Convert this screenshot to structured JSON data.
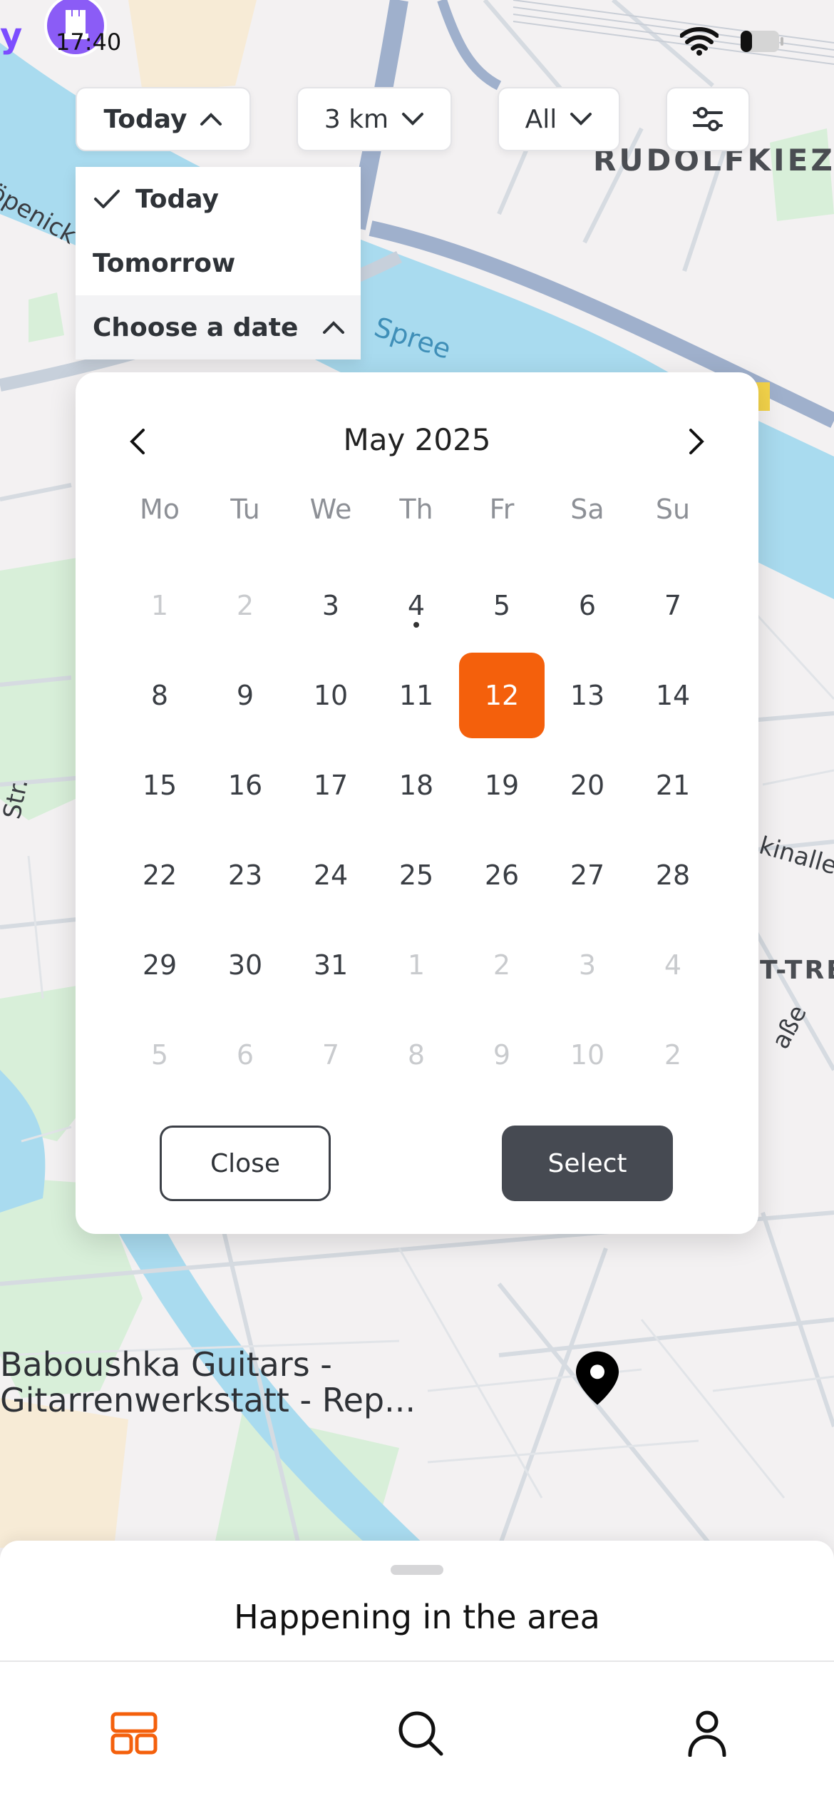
{
  "status_bar": {
    "time": "17:40",
    "brand_fragment": "y"
  },
  "filters": {
    "date_label": "Today",
    "distance_label": "3 km",
    "category_label": "All"
  },
  "date_dropdown": {
    "options": [
      {
        "label": "Today",
        "checked": true
      },
      {
        "label": "Tomorrow",
        "checked": false
      },
      {
        "label": "Choose a date",
        "expanded": true
      }
    ]
  },
  "calendar": {
    "month_title": "May 2025",
    "weekdays": [
      "Mo",
      "Tu",
      "We",
      "Th",
      "Fr",
      "Sa",
      "Su"
    ],
    "days": [
      {
        "n": "1",
        "muted": true
      },
      {
        "n": "2",
        "muted": true
      },
      {
        "n": "3"
      },
      {
        "n": "4",
        "dot": true
      },
      {
        "n": "5"
      },
      {
        "n": "6"
      },
      {
        "n": "7"
      },
      {
        "n": "8"
      },
      {
        "n": "9"
      },
      {
        "n": "10"
      },
      {
        "n": "11"
      },
      {
        "n": "12",
        "selected": true
      },
      {
        "n": "13"
      },
      {
        "n": "14"
      },
      {
        "n": "15"
      },
      {
        "n": "16"
      },
      {
        "n": "17"
      },
      {
        "n": "18"
      },
      {
        "n": "19"
      },
      {
        "n": "20"
      },
      {
        "n": "21"
      },
      {
        "n": "22"
      },
      {
        "n": "23"
      },
      {
        "n": "24"
      },
      {
        "n": "25"
      },
      {
        "n": "26"
      },
      {
        "n": "27"
      },
      {
        "n": "28"
      },
      {
        "n": "29"
      },
      {
        "n": "30"
      },
      {
        "n": "31"
      },
      {
        "n": "1",
        "muted": true
      },
      {
        "n": "2",
        "muted": true
      },
      {
        "n": "3",
        "muted": true
      },
      {
        "n": "4",
        "muted": true
      },
      {
        "n": "5",
        "muted": true
      },
      {
        "n": "6",
        "muted": true
      },
      {
        "n": "7",
        "muted": true
      },
      {
        "n": "8",
        "muted": true
      },
      {
        "n": "9",
        "muted": true
      },
      {
        "n": "10",
        "muted": true
      },
      {
        "n": "2",
        "muted": true
      }
    ],
    "close_label": "Close",
    "select_label": "Select",
    "accent_color": "#f4600c"
  },
  "map": {
    "labels": {
      "district": "RUDOLFKIEZ",
      "river": "Spree",
      "street_left_top": "öpenick",
      "street_left_mid": "Str.",
      "street_right": "kinalle",
      "area_right": "T-TRE",
      "street_right_low": "aße",
      "place_line1": "Baboushka Guitars -",
      "place_line2": "Gitarrenwerkstatt - Rep..."
    }
  },
  "sheet": {
    "title": "Happening in the area"
  },
  "tabbar": {
    "items": [
      "feed-icon",
      "search-icon",
      "profile-icon"
    ],
    "active_color": "#f4600c"
  }
}
